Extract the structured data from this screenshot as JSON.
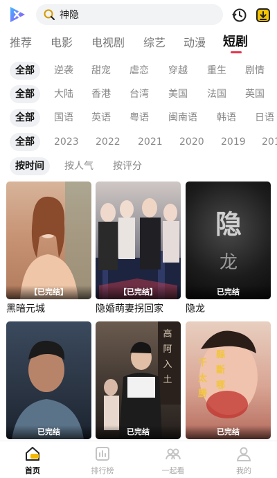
{
  "search": {
    "value": "神隐"
  },
  "category_tabs": [
    "推荐",
    "电影",
    "电视剧",
    "综艺",
    "动漫",
    "短剧"
  ],
  "active_tab": "短剧",
  "filters": {
    "genre": [
      "全部",
      "逆袭",
      "甜宠",
      "虐恋",
      "穿越",
      "重生",
      "剧情"
    ],
    "region": [
      "全部",
      "大陆",
      "香港",
      "台湾",
      "美国",
      "法国",
      "英国"
    ],
    "language": [
      "全部",
      "国语",
      "英语",
      "粤语",
      "闽南语",
      "韩语",
      "日语"
    ],
    "year": [
      "全部",
      "2023",
      "2022",
      "2021",
      "2020",
      "2019",
      "201"
    ],
    "sort": [
      "按时间",
      "按人气",
      "按评分"
    ]
  },
  "cards": [
    {
      "title": "黑暗元城",
      "badge": "【已完结】"
    },
    {
      "title": "隐婚萌妻拐回家",
      "badge": "【已完结】"
    },
    {
      "title": "隐龙",
      "badge": "已完结",
      "poster_text": [
        "隐",
        "龙"
      ]
    },
    {
      "title": "",
      "badge": "已完结"
    },
    {
      "title": "",
      "badge": "已完结",
      "poster_text": [
        "高",
        "阿",
        "入",
        "土"
      ]
    },
    {
      "title": "",
      "badge": "已完结",
      "poster_text": [
        "千",
        "太",
        "勝",
        "縣",
        "斷",
        "哪"
      ]
    }
  ],
  "bottom_nav": [
    "首页",
    "排行榜",
    "一起看",
    "我的"
  ],
  "colors": {
    "accent": "#e8344a",
    "logo": "#7b5cff"
  }
}
